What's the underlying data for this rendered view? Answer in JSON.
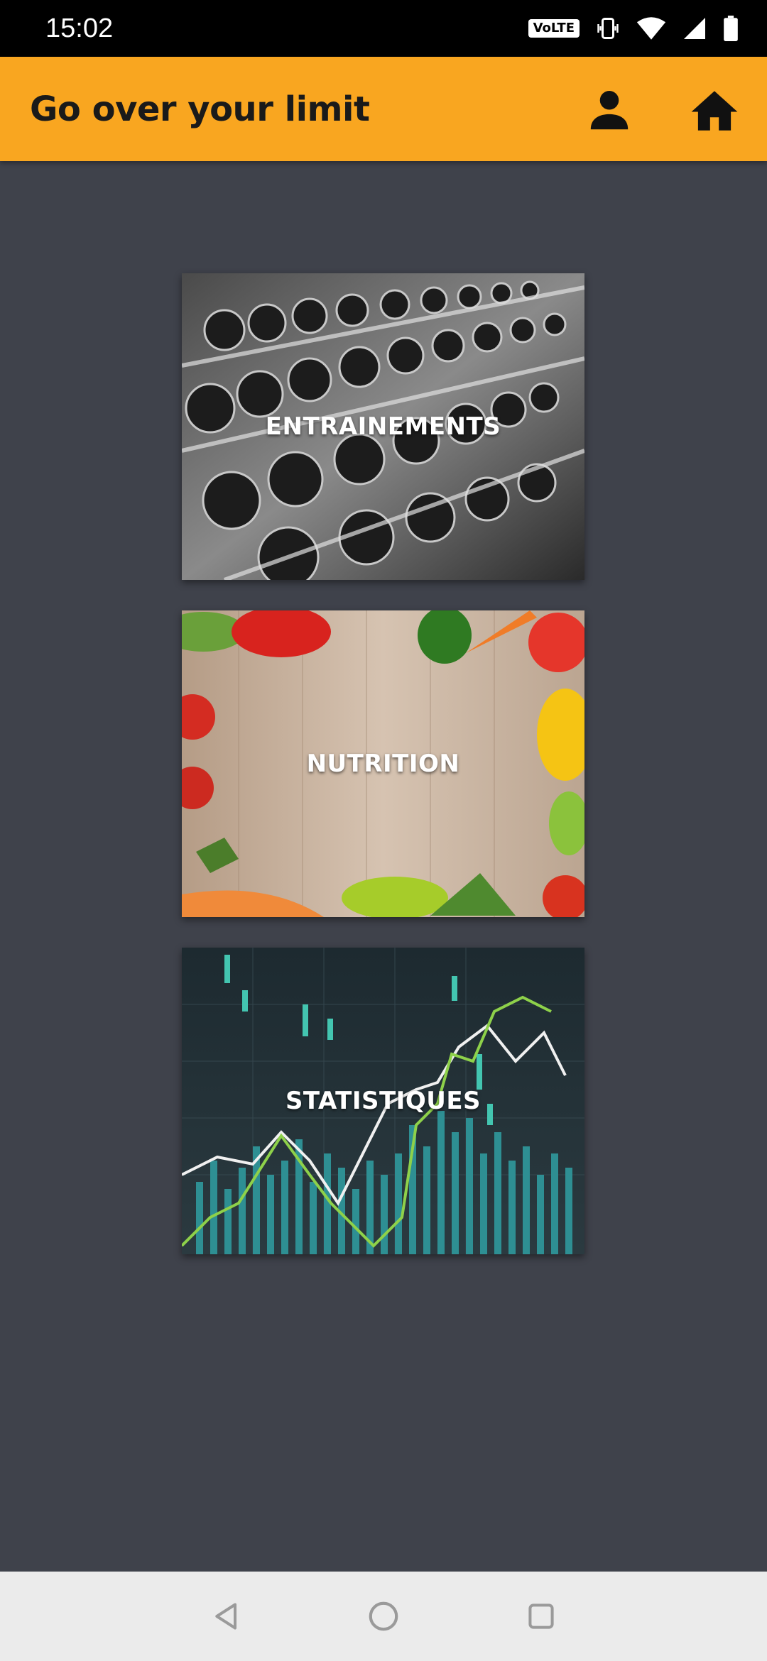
{
  "status_bar": {
    "time": "15:02",
    "volte_label": "VoLTE",
    "icons": [
      "volte-icon",
      "vibrate-icon",
      "wifi-icon",
      "signal-icon",
      "battery-icon"
    ]
  },
  "app_bar": {
    "title": "Go over your limit",
    "background_color": "#f9a620",
    "actions": [
      {
        "icon": "person-icon"
      },
      {
        "icon": "home-icon"
      }
    ]
  },
  "cards": [
    {
      "label": "ENTRAINEMENTS",
      "image": "dumbbell-rack-photo"
    },
    {
      "label": "NUTRITION",
      "image": "vegetables-on-wood-photo"
    },
    {
      "label": "STATISTIQUES",
      "image": "stock-chart-photo"
    }
  ],
  "nav_bar": {
    "buttons": [
      {
        "icon": "back-triangle-icon"
      },
      {
        "icon": "home-circle-icon"
      },
      {
        "icon": "recents-square-icon"
      }
    ]
  },
  "colors": {
    "page_background": "#3f424b",
    "accent": "#f9a620"
  }
}
